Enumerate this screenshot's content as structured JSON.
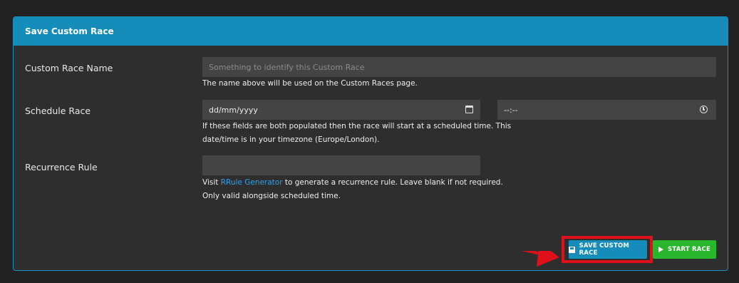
{
  "header": {
    "title": "Save Custom Race"
  },
  "form": {
    "name": {
      "label": "Custom Race Name",
      "placeholder": "Something to identify this Custom Race",
      "help": "The name above will be used on the Custom Races page."
    },
    "schedule": {
      "label": "Schedule Race",
      "date_value": "dd/mm/yyyy",
      "time_value": "--:--",
      "help_line1": "If these fields are both populated then the race will start at a scheduled time. This",
      "help_line2": "date/time is in your timezone (Europe/London)."
    },
    "recurrence": {
      "label": "Recurrence Rule",
      "value": "",
      "help_prefix": "Visit ",
      "help_link": "RRule Generator",
      "help_suffix": " to generate a recurrence rule. Leave blank if not required.",
      "help_line2": "Only valid alongside scheduled time."
    }
  },
  "actions": {
    "save_label": "SAVE CUSTOM RACE",
    "start_label": "START RACE"
  },
  "icons": {
    "date": "calendar-icon",
    "time": "clock-icon",
    "save": "floppy-disk-icon",
    "start": "play-icon"
  },
  "colors": {
    "header": "#158cba",
    "save": "#158cba",
    "start": "#28b62c",
    "link": "#2fa4e7",
    "highlight": "#e0101a"
  }
}
